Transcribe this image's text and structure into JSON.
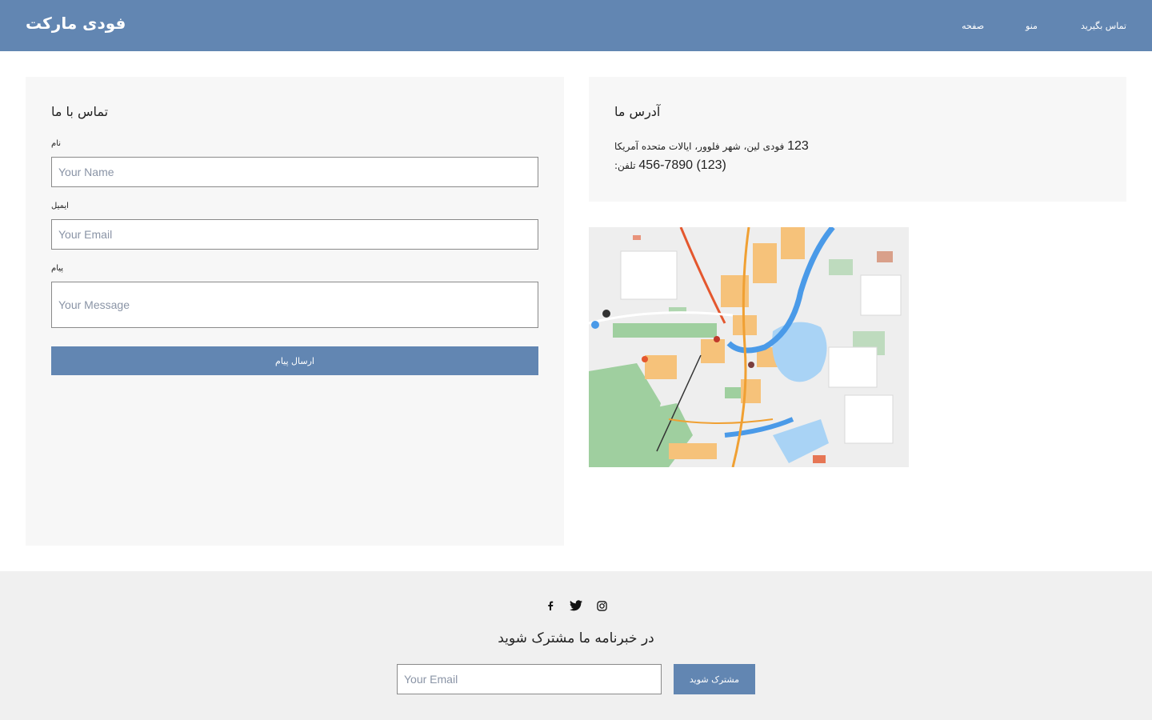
{
  "header": {
    "logo": "فودی مارکت",
    "nav": [
      "صفحه",
      "منو",
      "تماس بگیرید"
    ]
  },
  "contact": {
    "title": "تماس با ما",
    "name_label": "نام",
    "name_placeholder": "Your Name",
    "email_label": "ایمیل",
    "email_placeholder": "Your Email",
    "message_label": "پیام",
    "message_placeholder": "Your Message",
    "submit_label": "ارسال پیام"
  },
  "address": {
    "title": "آدرس ما",
    "street_text": "فودی لین، شهر فلوور، ایالات متحده آمریکا",
    "street_number": "123",
    "phone_label": "تلفن:",
    "phone_number": "(123) 456-7890"
  },
  "footer": {
    "socials": [
      "facebook-icon",
      "twitter-icon",
      "instagram-icon"
    ],
    "newsletter_title": "در خبرنامه ما مشترک شوید",
    "email_placeholder": "Your Email",
    "subscribe_label": "مشترک شوید"
  },
  "colors": {
    "primary": "#6286b2",
    "card_bg": "#f7f7f7",
    "footer_bg": "#f0f0f0"
  }
}
